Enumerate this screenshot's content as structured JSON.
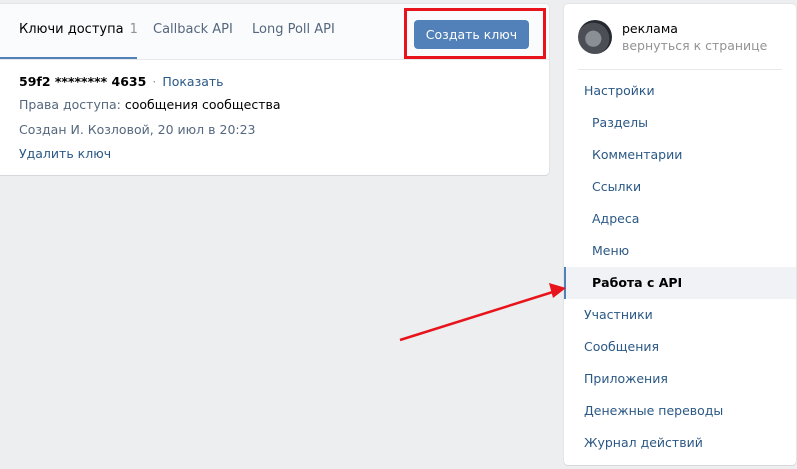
{
  "tabs": {
    "keys_label": "Ключи доступа",
    "keys_count": "1",
    "callback_label": "Callback API",
    "longpoll_label": "Long Poll API"
  },
  "create_button_label": "Создать ключ",
  "key": {
    "id": "59f2 ******** 4635",
    "separator": "·",
    "show_label": "Показать",
    "rights_label": "Права доступа:",
    "rights_value": "сообщения сообщества",
    "created": "Создан И. Козловой, 20 июл в 20:23",
    "delete_label": "Удалить ключ"
  },
  "group": {
    "name": "реклама",
    "back_label": "вернуться к странице"
  },
  "menu": [
    {
      "label": "Настройки"
    },
    {
      "label": "Разделы"
    },
    {
      "label": "Комментарии"
    },
    {
      "label": "Ссылки"
    },
    {
      "label": "Адреса"
    },
    {
      "label": "Меню"
    },
    {
      "label": "Работа с API"
    },
    {
      "label": "Участники"
    },
    {
      "label": "Сообщения"
    },
    {
      "label": "Приложения"
    },
    {
      "label": "Денежные переводы"
    },
    {
      "label": "Журнал действий"
    }
  ],
  "colors": {
    "accent": "#5181b8",
    "link": "#2a5885",
    "annotation": "#e8141c"
  }
}
